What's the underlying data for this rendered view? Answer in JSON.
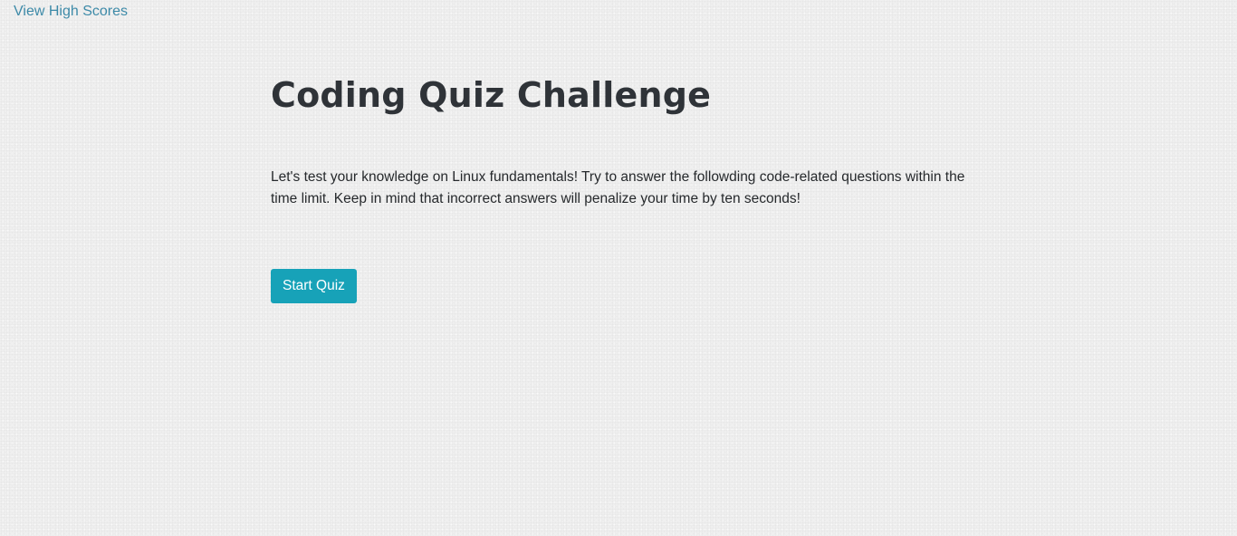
{
  "header": {
    "high_scores_link": "View High Scores"
  },
  "main": {
    "title": "Coding Quiz Challenge",
    "intro": "Let's test your knowledge on Linux fundamentals! Try to answer the followding code-related questions within the time limit. Keep in mind that incorrect answers will penalize your time by ten seconds!",
    "start_button": "Start Quiz"
  },
  "colors": {
    "background": "#efefef",
    "link": "#3d8aa8",
    "title": "#2f3338",
    "button": "#17a2b8",
    "button_text": "#ffffff"
  }
}
